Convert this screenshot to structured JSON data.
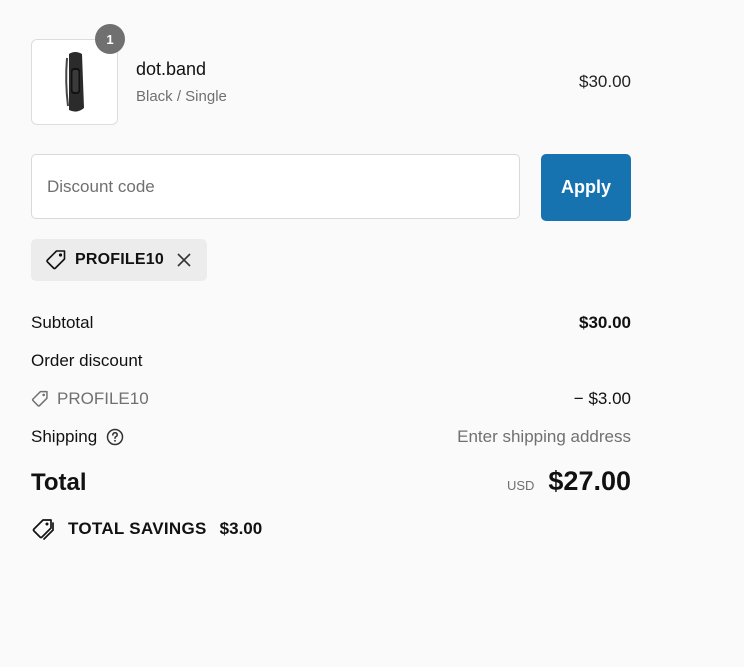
{
  "cart": {
    "item": {
      "quantity": "1",
      "name": "dot.band",
      "variant": "Black / Single",
      "price": "$30.00",
      "image_icon": "fitness-band-image"
    }
  },
  "discount": {
    "placeholder": "Discount code",
    "value": "",
    "apply_label": "Apply",
    "applied_code": "PROFILE10"
  },
  "summary": {
    "subtotal_label": "Subtotal",
    "subtotal_value": "$30.00",
    "order_discount_label": "Order discount",
    "discount_code": "PROFILE10",
    "discount_value": "− $3.00",
    "shipping_label": "Shipping",
    "shipping_value": "Enter shipping address",
    "total_label": "Total",
    "currency": "USD",
    "total_value": "$27.00",
    "savings_label": "TOTAL SAVINGS",
    "savings_value": "$3.00"
  },
  "colors": {
    "accent": "#1773b0",
    "muted_text": "#707070",
    "background": "#fafafa"
  }
}
